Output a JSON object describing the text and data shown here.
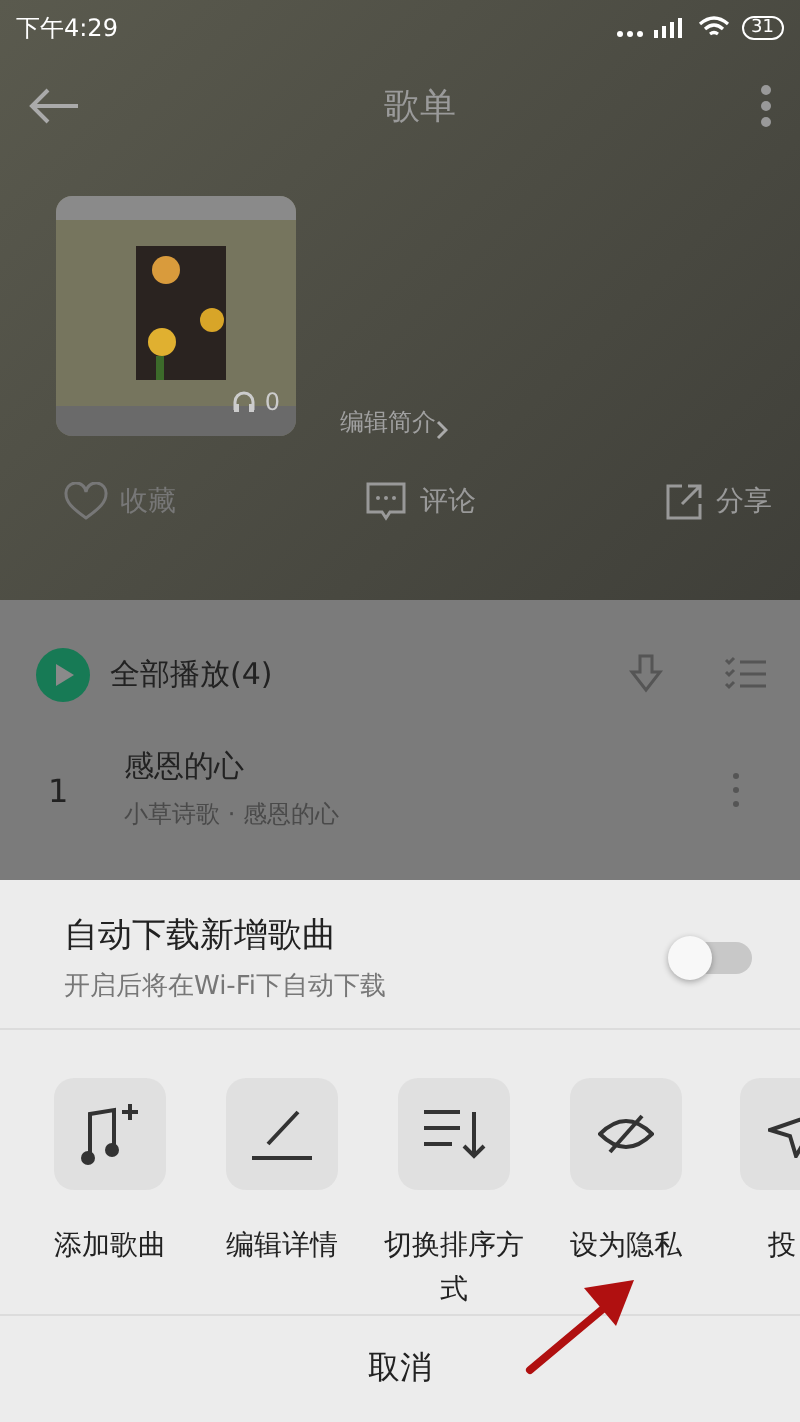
{
  "status_bar": {
    "time": "下午4:29",
    "battery": "31"
  },
  "header": {
    "title": "歌单"
  },
  "playlist": {
    "play_count": "0",
    "edit_intro": "编辑简介"
  },
  "actions": [
    {
      "kind": "favorite",
      "label": "收藏"
    },
    {
      "kind": "comment",
      "label": "评论"
    },
    {
      "kind": "share",
      "label": "分享"
    }
  ],
  "play_all": {
    "label": "全部播放(4)"
  },
  "songs": [
    {
      "index": "1",
      "title": "感恩的心",
      "subtitle": "小草诗歌 · 感恩的心"
    }
  ],
  "sheet": {
    "auto_download": {
      "title": "自动下载新增歌曲",
      "subtitle": "开启后将在Wi-Fi下自动下载",
      "on": false
    },
    "items": [
      {
        "kind": "add_song",
        "label": "添加歌曲"
      },
      {
        "kind": "edit",
        "label": "编辑详情"
      },
      {
        "kind": "sort",
        "label": "切换排序方式"
      },
      {
        "kind": "private",
        "label": "设为隐私"
      },
      {
        "kind": "send",
        "label": "投"
      }
    ],
    "cancel": "取消"
  }
}
